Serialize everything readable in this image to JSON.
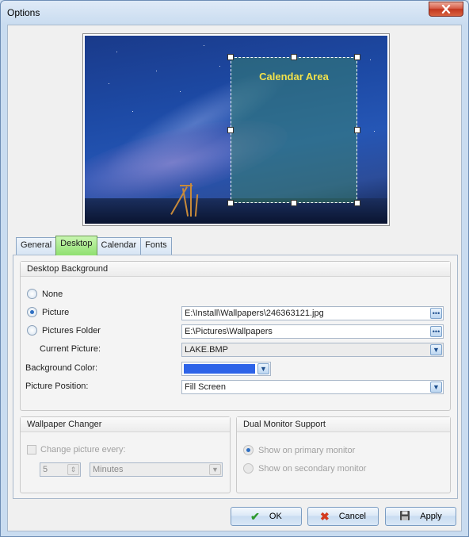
{
  "window": {
    "title": "Options"
  },
  "preview": {
    "calendar_label": "Calendar Area"
  },
  "tabs": [
    {
      "label": "General",
      "active": false
    },
    {
      "label": "Desktop",
      "active": true
    },
    {
      "label": "Calendar",
      "active": false
    },
    {
      "label": "Fonts",
      "active": false
    }
  ],
  "desktop_background": {
    "title": "Desktop Background",
    "none_label": "None",
    "picture_label": "Picture",
    "picture_path": "E:\\Install\\Wallpapers\\246363121.jpg",
    "folder_label": "Pictures Folder",
    "folder_path": "E:\\Pictures\\Wallpapers",
    "current_label": "Current Picture:",
    "current_value": "LAKE.BMP",
    "bgcolor_label": "Background Color:",
    "bgcolor_value": "#2d63e8",
    "position_label": "Picture Position:",
    "position_value": "Fill Screen",
    "selected": "Picture"
  },
  "wallpaper_changer": {
    "title": "Wallpaper Changer",
    "change_label": "Change picture every:",
    "interval_value": "5",
    "unit_value": "Minutes"
  },
  "dual_monitor": {
    "title": "Dual Monitor Support",
    "primary_label": "Show on primary monitor",
    "secondary_label": "Show on secondary monitor"
  },
  "buttons": {
    "ok": "OK",
    "cancel": "Cancel",
    "apply": "Apply"
  },
  "icons": {
    "browse": "ellipsis-icon",
    "dropdown": "chevron-down-icon",
    "ok": "check-icon",
    "cancel": "x-icon",
    "apply": "floppy-disk-icon"
  }
}
